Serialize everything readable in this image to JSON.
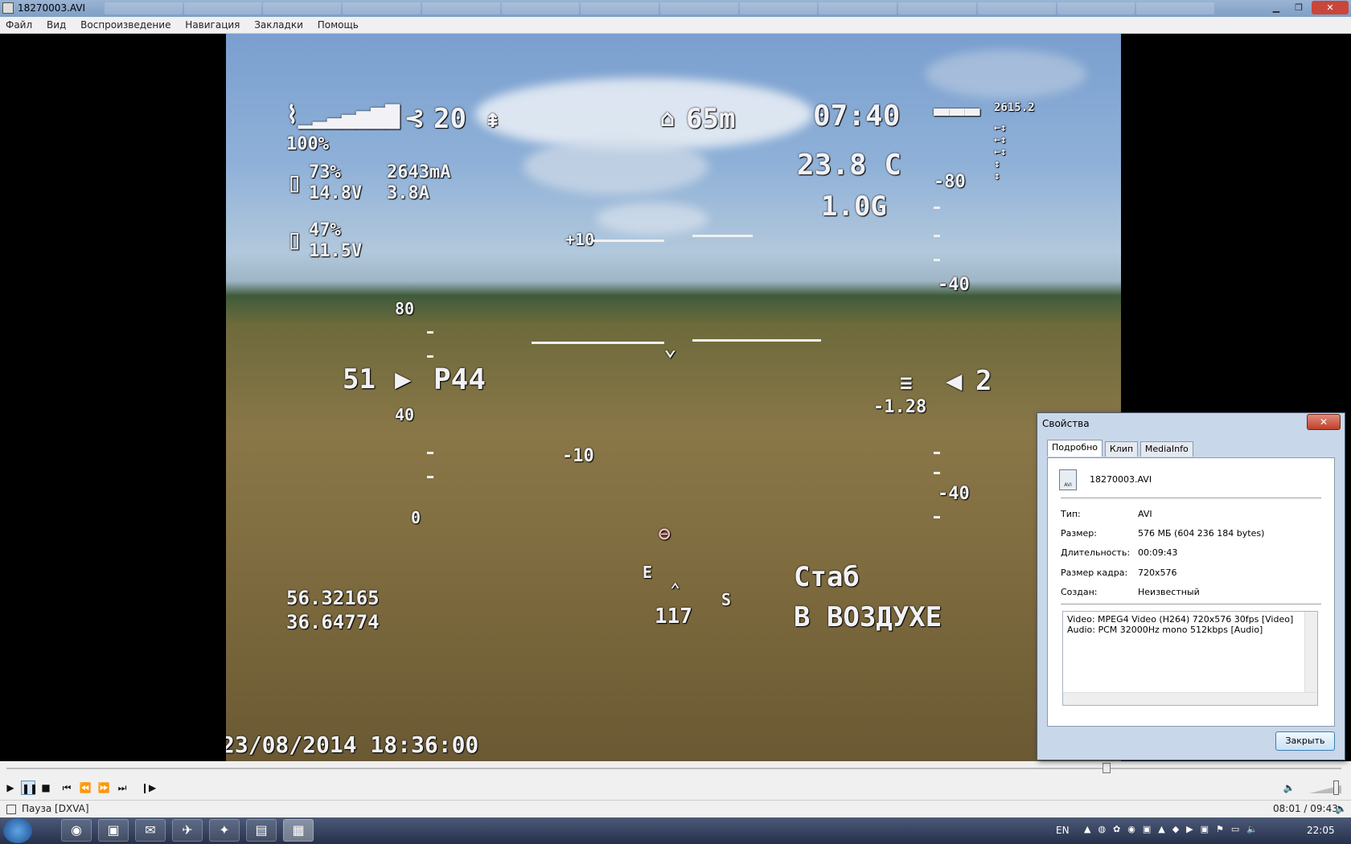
{
  "window": {
    "title": "18270003.AVI",
    "buttons": {
      "minimize": "▁",
      "maximize": "❐",
      "close": "✕"
    }
  },
  "menu": [
    "Файл",
    "Вид",
    "Воспроизведение",
    "Навигация",
    "Закладки",
    "Помощь"
  ],
  "osd": {
    "rssi": "100%",
    "sats": "20",
    "altitude": "65m",
    "flight_time": "07:40",
    "battery1_percent": "73%",
    "battery1_voltage": "14.8V",
    "battery1_mah": "2643mA",
    "battery1_current": "3.8A",
    "battery2_percent": "47%",
    "battery2_voltage": "11.5V",
    "temperature": "23.8 C",
    "gforce": "1.0G",
    "top_right_readout": "2615.2",
    "pitch_plus10": "+10",
    "pitch_minus10": "-10",
    "speed_scale": [
      "80",
      "40",
      "0"
    ],
    "alt_scale": [
      "-80",
      "-40",
      "-40"
    ],
    "speed": "51",
    "heading_label": "P44",
    "vario_value": "2",
    "vario_rate": "-1.28",
    "heading_marker": "117",
    "compass_e": "E",
    "compass_s": "S",
    "latitude": "56.32165",
    "longitude": "36.64774",
    "mode": "Стаб",
    "status": "В ВОЗДУХЕ",
    "timestamp": "23/08/2014 18:36:00"
  },
  "dialog": {
    "title": "Свойства",
    "close_label": "✕",
    "tabs": [
      "Подробно",
      "Клип",
      "MediaInfo"
    ],
    "file_name": "18270003.AVI",
    "file_icon_text": "AVI",
    "rows": [
      {
        "label": "Тип:",
        "value": "AVI"
      },
      {
        "label": "Размер:",
        "value": "576 МБ (604 236 184 bytes)"
      },
      {
        "label": "Длительность:",
        "value": "00:09:43"
      },
      {
        "label": "Размер кадра:",
        "value": "720x576"
      },
      {
        "label": "Создан:",
        "value": "Неизвестный"
      }
    ],
    "streams": [
      "Video: MPEG4 Video (H264) 720x576 30fps [Video]",
      "Audio: PCM 32000Hz mono 512kbps [Audio]"
    ],
    "ok_label": "Закрыть"
  },
  "playback": {
    "progress": 0.824,
    "status": "Пауза [DXVA]",
    "time": "08:01 / 09:43"
  },
  "taskbar": {
    "language": "EN",
    "clock": "22:05"
  }
}
